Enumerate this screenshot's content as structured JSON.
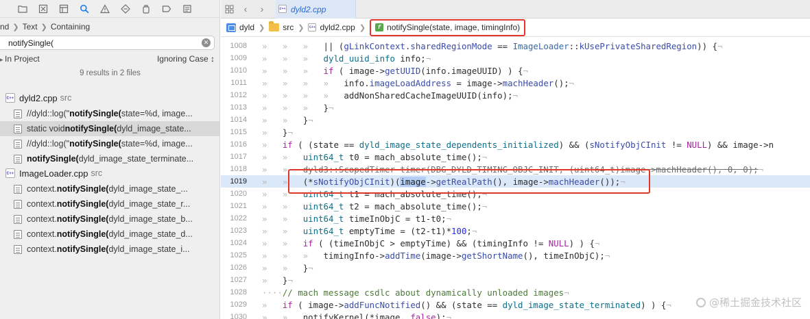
{
  "navigator": {
    "breadcrumb": [
      "nd",
      "Text",
      "Containing"
    ],
    "search": {
      "value": "notifySingle(",
      "placeholder": ""
    },
    "scope": {
      "left": "In Project",
      "right": "Ignoring Case ↕"
    },
    "summary": "9 results in 2 files",
    "files": [
      {
        "name": "dyld2.cpp",
        "dir": "src",
        "matches": [
          {
            "pre": "//dyld::log(\"",
            "hit": "notifySingle(",
            "post": "state=%d, image...",
            "selected": false
          },
          {
            "pre": "static void ",
            "hit": "notifySingle(",
            "post": "dyld_image_state...",
            "selected": true
          },
          {
            "pre": "//dyld::log(\"",
            "hit": "notifySingle(",
            "post": "state=%d, image...",
            "selected": false
          },
          {
            "pre": "",
            "hit": "notifySingle(",
            "post": "dyld_image_state_terminate...",
            "selected": false
          }
        ]
      },
      {
        "name": "ImageLoader.cpp",
        "dir": "src",
        "matches": [
          {
            "pre": "context.",
            "hit": "notifySingle(",
            "post": "dyld_image_state_...",
            "selected": false
          },
          {
            "pre": "context.",
            "hit": "notifySingle(",
            "post": "dyld_image_state_r...",
            "selected": false
          },
          {
            "pre": "context.",
            "hit": "notifySingle(",
            "post": "dyld_image_state_b...",
            "selected": false
          },
          {
            "pre": "context.",
            "hit": "notifySingle(",
            "post": "dyld_image_state_d...",
            "selected": false
          },
          {
            "pre": "context.",
            "hit": "notifySingle(",
            "post": "dyld_image_state_i...",
            "selected": false
          }
        ]
      }
    ]
  },
  "editor": {
    "tab": "dyld2.cpp",
    "jump_bar": {
      "project": "dyld",
      "folder": "src",
      "file": "dyld2.cpp",
      "function": "notifySingle(state, image, timingInfo)"
    },
    "current_line": 1019,
    "lines": [
      {
        "n": "1008",
        "tokens": [
          [
            "inv",
            "»   »   »   "
          ],
          [
            "pl",
            "|| ("
          ],
          [
            "mem",
            "gLinkContext"
          ],
          [
            "pl",
            "."
          ],
          [
            "mem",
            "sharedRegionMode"
          ],
          [
            "pl",
            " == "
          ],
          [
            "cls",
            "ImageLoader"
          ],
          [
            "pl",
            "::"
          ],
          [
            "mem",
            "kUsePrivateSharedRegion"
          ],
          [
            "pl",
            ")) {"
          ],
          [
            "inv",
            "¬"
          ]
        ]
      },
      {
        "n": "1009",
        "tokens": [
          [
            "inv",
            "»   »   »   "
          ],
          [
            "ty",
            "dyld_uuid_info"
          ],
          [
            "pl",
            " info;"
          ],
          [
            "inv",
            "¬"
          ]
        ]
      },
      {
        "n": "1010",
        "tokens": [
          [
            "inv",
            "»   »   »   "
          ],
          [
            "kw",
            "if"
          ],
          [
            "pl",
            " ( image->"
          ],
          [
            "fn",
            "getUUID"
          ],
          [
            "pl",
            "(info.imageUUID) ) {"
          ],
          [
            "inv",
            "¬"
          ]
        ]
      },
      {
        "n": "1011",
        "tokens": [
          [
            "inv",
            "»   »   »   »   "
          ],
          [
            "pl",
            "info."
          ],
          [
            "mem",
            "imageLoadAddress"
          ],
          [
            "pl",
            " = image->"
          ],
          [
            "fn",
            "machHeader"
          ],
          [
            "pl",
            "();"
          ],
          [
            "inv",
            "¬"
          ]
        ]
      },
      {
        "n": "1012",
        "tokens": [
          [
            "inv",
            "»   »   »   »   "
          ],
          [
            "pl",
            "addNonSharedCacheImageUUID(info);"
          ],
          [
            "inv",
            "¬"
          ]
        ]
      },
      {
        "n": "1013",
        "tokens": [
          [
            "inv",
            "»   »   »   "
          ],
          [
            "pl",
            "}"
          ],
          [
            "inv",
            "¬"
          ]
        ]
      },
      {
        "n": "1014",
        "tokens": [
          [
            "inv",
            "»   »   "
          ],
          [
            "pl",
            "}"
          ],
          [
            "inv",
            "¬"
          ]
        ]
      },
      {
        "n": "1015",
        "tokens": [
          [
            "inv",
            "»   "
          ],
          [
            "pl",
            "}"
          ],
          [
            "inv",
            "¬"
          ]
        ]
      },
      {
        "n": "1016",
        "tokens": [
          [
            "inv",
            "»   "
          ],
          [
            "kw",
            "if"
          ],
          [
            "pl",
            " ( (state == "
          ],
          [
            "ty",
            "dyld_image_state_dependents_initialized"
          ],
          [
            "pl",
            ") && ("
          ],
          [
            "mem",
            "sNotifyObjCInit"
          ],
          [
            "pl",
            " != "
          ],
          [
            "kw",
            "NULL"
          ],
          [
            "pl",
            ") && image->n"
          ]
        ]
      },
      {
        "n": "1017",
        "tokens": [
          [
            "inv",
            "»   »   "
          ],
          [
            "ty",
            "uint64_t"
          ],
          [
            "pl",
            " t0 = mach_absolute_time();"
          ],
          [
            "inv",
            "¬"
          ]
        ]
      },
      {
        "n": "1018",
        "tokens": [
          [
            "inv",
            "»   »   "
          ],
          [
            "strike",
            "dyld3::ScopedTimer timer(DBG_DYLD_TIMING_OBJC_INIT, (uint64_t)image->machHeader(), 0, 0);"
          ],
          [
            "inv",
            "¬"
          ]
        ]
      },
      {
        "n": "1019",
        "tokens": [
          [
            "inv",
            "»   »   "
          ],
          [
            "pl",
            "(*"
          ],
          [
            "mem",
            "sNotifyObjCInit"
          ],
          [
            "pl",
            ")("
          ],
          [
            "selw",
            "image"
          ],
          [
            "pl",
            "->"
          ],
          [
            "fn",
            "getRealPath"
          ],
          [
            "pl",
            "(), image->"
          ],
          [
            "fn",
            "machHeader"
          ],
          [
            "pl",
            "());"
          ],
          [
            "inv",
            "¬"
          ]
        ]
      },
      {
        "n": "1020",
        "tokens": [
          [
            "inv",
            "»   »   "
          ],
          [
            "ty",
            "uint64_t"
          ],
          [
            "pl",
            " t1 = mach_absolute_time();"
          ],
          [
            "inv",
            "¬"
          ]
        ]
      },
      {
        "n": "1021",
        "tokens": [
          [
            "inv",
            "»   »   "
          ],
          [
            "ty",
            "uint64_t"
          ],
          [
            "pl",
            " t2 = mach_absolute_time();"
          ],
          [
            "inv",
            "¬"
          ]
        ]
      },
      {
        "n": "1022",
        "tokens": [
          [
            "inv",
            "»   »   "
          ],
          [
            "ty",
            "uint64_t"
          ],
          [
            "pl",
            " timeInObjC = t1-t0;"
          ],
          [
            "inv",
            "¬"
          ]
        ]
      },
      {
        "n": "1023",
        "tokens": [
          [
            "inv",
            "»   »   "
          ],
          [
            "ty",
            "uint64_t"
          ],
          [
            "pl",
            " emptyTime = (t2-t1)*"
          ],
          [
            "num",
            "100"
          ],
          [
            "pl",
            ";"
          ],
          [
            "inv",
            "¬"
          ]
        ]
      },
      {
        "n": "1024",
        "tokens": [
          [
            "inv",
            "»   »   "
          ],
          [
            "kw",
            "if"
          ],
          [
            "pl",
            " ( (timeInObjC > emptyTime) && (timingInfo != "
          ],
          [
            "kw",
            "NULL"
          ],
          [
            "pl",
            ") ) {"
          ],
          [
            "inv",
            "¬"
          ]
        ]
      },
      {
        "n": "1025",
        "tokens": [
          [
            "inv",
            "»   »   »   "
          ],
          [
            "pl",
            "timingInfo->"
          ],
          [
            "fn",
            "addTime"
          ],
          [
            "pl",
            "(image->"
          ],
          [
            "fn",
            "getShortName"
          ],
          [
            "pl",
            "(), timeInObjC);"
          ],
          [
            "inv",
            "¬"
          ]
        ]
      },
      {
        "n": "1026",
        "tokens": [
          [
            "inv",
            "»   »   "
          ],
          [
            "pl",
            "}"
          ],
          [
            "inv",
            "¬"
          ]
        ]
      },
      {
        "n": "1027",
        "tokens": [
          [
            "inv",
            "»   "
          ],
          [
            "pl",
            "}"
          ],
          [
            "inv",
            "¬"
          ]
        ]
      },
      {
        "n": "1028",
        "tokens": [
          [
            "inv",
            "····"
          ],
          [
            "cm",
            "// mach message csdlc about dynamically unloaded images"
          ],
          [
            "inv",
            "¬"
          ]
        ]
      },
      {
        "n": "1029",
        "tokens": [
          [
            "inv",
            "»   "
          ],
          [
            "kw",
            "if"
          ],
          [
            "pl",
            " ( image->"
          ],
          [
            "fn",
            "addFuncNotified"
          ],
          [
            "pl",
            "() && (state == "
          ],
          [
            "ty",
            "dyld_image_state_terminated"
          ],
          [
            "pl",
            ") ) {"
          ],
          [
            "inv",
            "¬"
          ]
        ]
      },
      {
        "n": "1030",
        "tokens": [
          [
            "inv",
            "»   »   "
          ],
          [
            "pl",
            "notifyKernel(*image, "
          ],
          [
            "kw",
            "false"
          ],
          [
            "pl",
            ");"
          ],
          [
            "inv",
            "¬"
          ]
        ]
      }
    ]
  },
  "watermark": "@稀土掘金技术社区",
  "colors": {
    "accent": "#1a7cf5",
    "annotation_red": "#e0372a",
    "current_line": "#dbe8fa"
  }
}
